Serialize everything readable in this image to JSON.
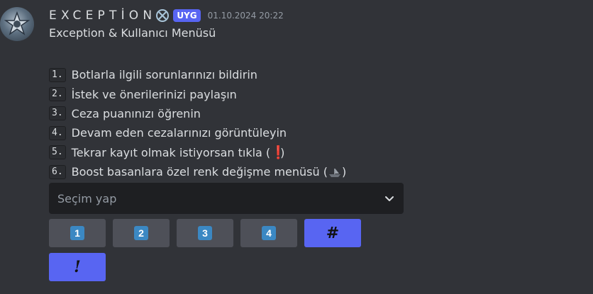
{
  "message": {
    "username": "EXCEPTİON",
    "tag": "UYG",
    "timestamp": "01.10.2024 20:22",
    "title": "Exception & Kullanıcı Menüsü",
    "items": [
      {
        "num": "1.",
        "text": "Botlarla ilgili sorunlarınızı bildirin"
      },
      {
        "num": "2.",
        "text": "İstek ve önerilerinizi paylaşın"
      },
      {
        "num": "3.",
        "text": "Ceza puanınızı öğrenin"
      },
      {
        "num": "4.",
        "text": "Devam eden cezalarınızı görüntüleyin"
      },
      {
        "num": "5.",
        "text": "Tekrar kayıt olmak istiyorsan tıkla (",
        "emoji": "exclamation",
        "suffix": ")"
      },
      {
        "num": "6.",
        "text": "Boost basanlara özel renk değişme menüsü (",
        "emoji": "boat",
        "suffix": ")"
      }
    ]
  },
  "select": {
    "placeholder": "Seçim yap"
  },
  "buttons": [
    {
      "label": "1",
      "style": "gray",
      "icon": "keycap-1"
    },
    {
      "label": "2",
      "style": "gray",
      "icon": "keycap-2"
    },
    {
      "label": "3",
      "style": "gray",
      "icon": "keycap-3"
    },
    {
      "label": "4",
      "style": "gray",
      "icon": "keycap-4"
    },
    {
      "label": "#",
      "style": "blurple",
      "icon": "hash"
    },
    {
      "label": "!",
      "style": "blurple",
      "icon": "exclamation"
    }
  ],
  "colors": {
    "background": "#313338",
    "blurple": "#5865f2",
    "gray_button": "#4e5058",
    "keycap": "#3b88c3"
  }
}
